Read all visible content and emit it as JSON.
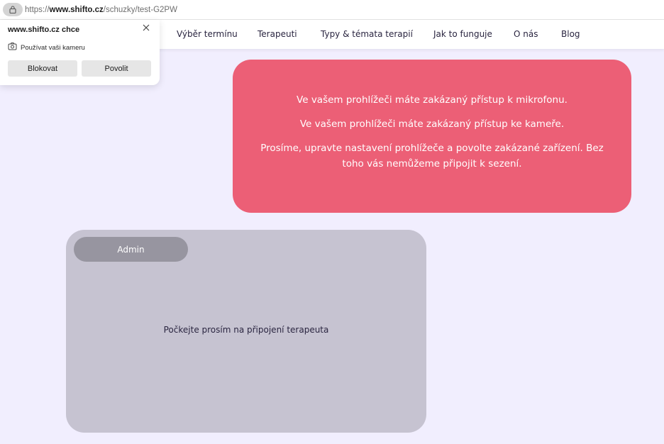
{
  "browser": {
    "url_scheme": "https://",
    "url_host": "www.shifto.cz",
    "url_path": "/schuzky/test-G2PW",
    "lock_icon": "lock-icon"
  },
  "nav": {
    "items": [
      {
        "label": "Výběr termínu"
      },
      {
        "label": "Terapeuti"
      },
      {
        "label": "Typy & témata terapií"
      },
      {
        "label": "Jak to funguje"
      },
      {
        "label": "O nás"
      },
      {
        "label": "Blog"
      }
    ]
  },
  "permission_prompt": {
    "title": "www.shifto.cz chce",
    "request": "Používat vaši kameru",
    "request_icon": "camera-icon",
    "close_icon": "close-icon",
    "block_label": "Blokovat",
    "allow_label": "Povolit"
  },
  "alert": {
    "color": "#ec5f76",
    "line1": "Ve vašem prohlížeči máte zakázaný přístup k mikrofonu.",
    "line2": "Ve vašem prohlížeči máte zakázaný přístup ke kameře.",
    "line3": "Prosíme, upravte nastavení prohlížeče a povolte zakázané zařízení. Bez toho vás nemůžeme připojit k sezení."
  },
  "video_tile": {
    "participant_name": "Admin",
    "waiting_text": "Počkejte prosím na připojení terapeuta"
  }
}
